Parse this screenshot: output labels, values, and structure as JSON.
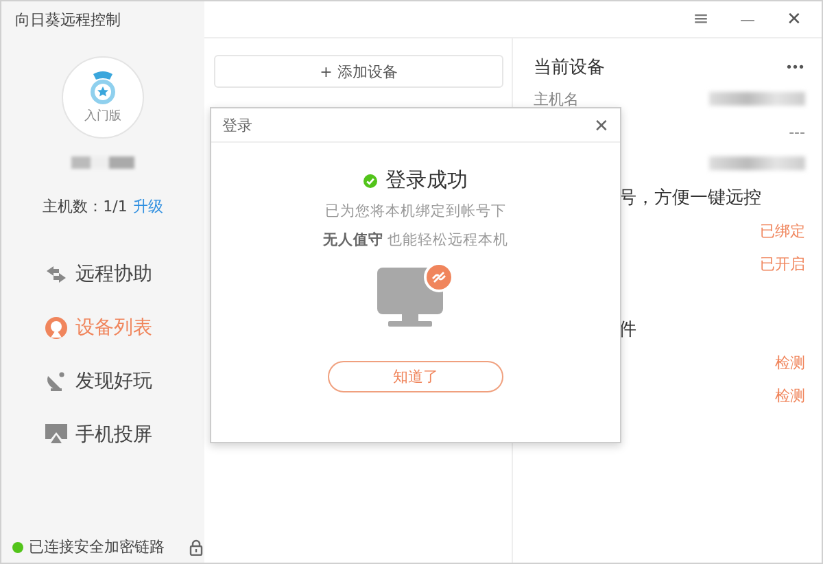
{
  "app_title": "向日葵远程控制",
  "window_controls": [
    {
      "kind": "menu",
      "text": "≡"
    },
    {
      "kind": "minimize",
      "text": "—"
    },
    {
      "kind": "close",
      "text": "✕"
    }
  ],
  "sidebar": {
    "edition": "入门版",
    "host_count_label": "主机数：1/1",
    "upgrade_link": "升级",
    "items": [
      {
        "kind": "swap",
        "label": "远程协助",
        "selected": false
      },
      {
        "kind": "devices",
        "label": "设备列表",
        "selected": true
      },
      {
        "kind": "satellite",
        "label": "发现好玩",
        "selected": false
      },
      {
        "kind": "cast",
        "label": "手机投屏",
        "selected": false
      }
    ],
    "status": {
      "text": "已连接安全加密链路",
      "connected": true
    }
  },
  "device_list": {
    "add_button": "+ 添加设备"
  },
  "device_panel": {
    "title": "当前设备",
    "more": "•••",
    "rows": [
      {
        "kind": "label",
        "text": "主机名"
      },
      {
        "kind": "value",
        "text": "---"
      },
      {
        "kind": "note",
        "text": "号，方便一键远控"
      },
      {
        "kind": "status",
        "text": "已绑定"
      },
      {
        "kind": "status",
        "text": "已开启"
      },
      {
        "kind": "note",
        "text": "件"
      },
      {
        "kind": "status",
        "text": "检测"
      },
      {
        "kind": "status",
        "text": "检测"
      }
    ]
  },
  "dialog": {
    "title": "登录",
    "close": "✕",
    "heading": "登录成功",
    "message_lines": [
      "已为您将本机绑定到帐号下",
      "**无人值守** 也能轻松远程本机"
    ],
    "button": "知道了"
  }
}
